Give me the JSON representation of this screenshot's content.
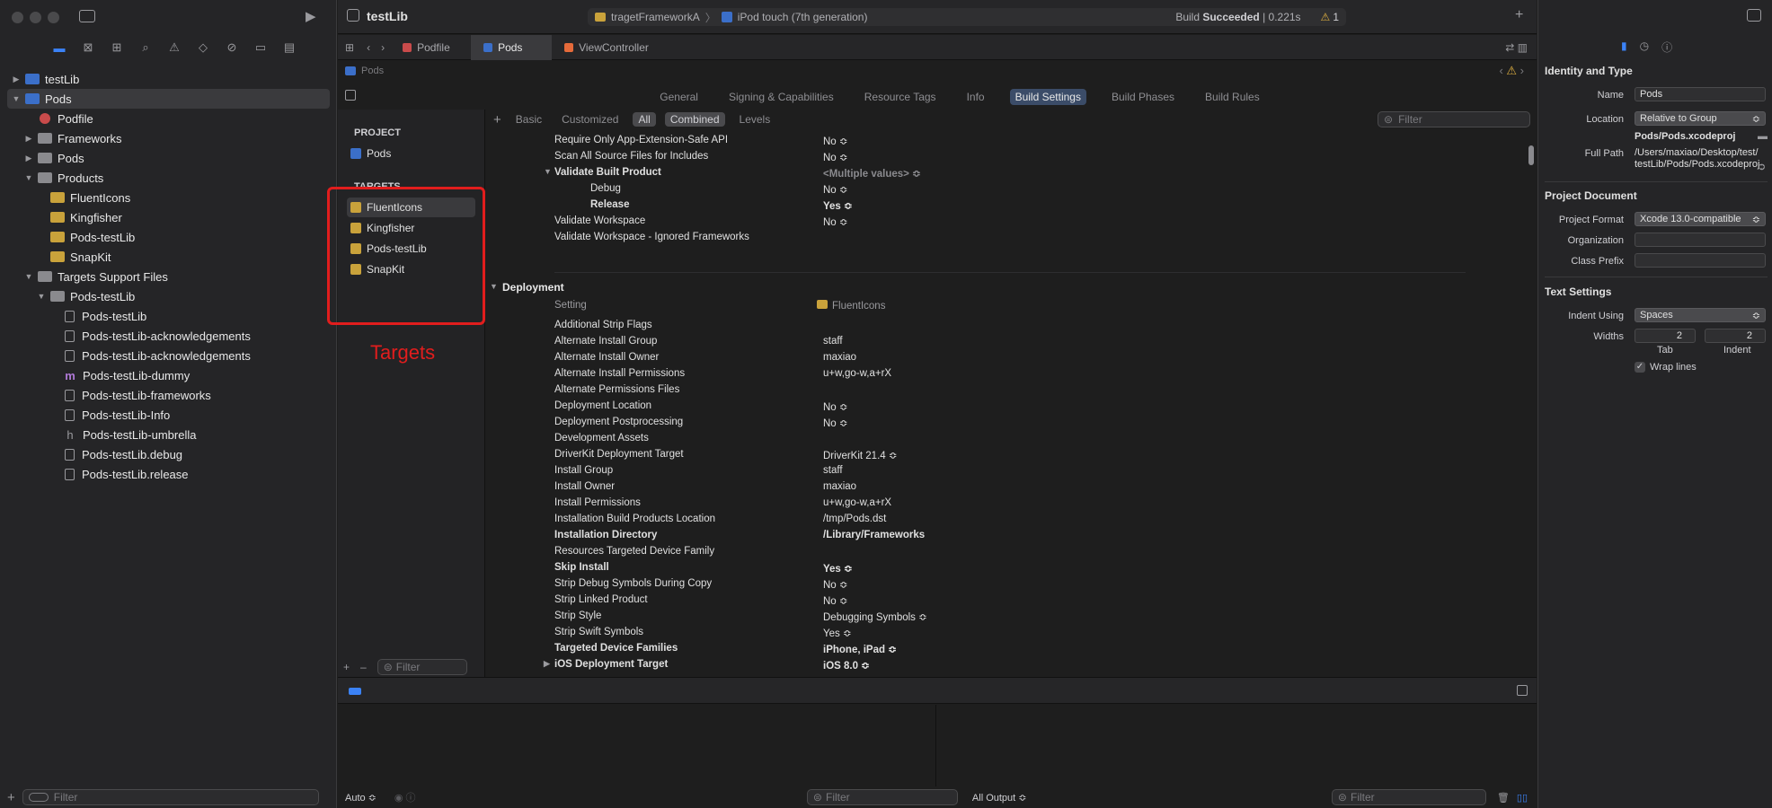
{
  "navigator": {
    "tree": [
      {
        "label": "testLib",
        "icon": "project-icon",
        "disc": "▶",
        "indent": 0
      },
      {
        "label": "Pods",
        "icon": "project-icon",
        "disc": "▼",
        "indent": 0,
        "selected": true
      },
      {
        "label": "Podfile",
        "icon": "podfile-icon",
        "disc": "",
        "indent": 1
      },
      {
        "label": "Frameworks",
        "icon": "folder-icon",
        "disc": "▶",
        "indent": 1
      },
      {
        "label": "Pods",
        "icon": "folder-icon",
        "disc": "▶",
        "indent": 1
      },
      {
        "label": "Products",
        "icon": "folder-icon",
        "disc": "▼",
        "indent": 1
      },
      {
        "label": "FluentIcons",
        "icon": "framework-icon",
        "disc": "",
        "indent": 2
      },
      {
        "label": "Kingfisher",
        "icon": "framework-icon",
        "disc": "",
        "indent": 2
      },
      {
        "label": "Pods-testLib",
        "icon": "framework-icon",
        "disc": "",
        "indent": 2
      },
      {
        "label": "SnapKit",
        "icon": "framework-icon",
        "disc": "",
        "indent": 2
      },
      {
        "label": "Targets Support Files",
        "icon": "folder-icon",
        "disc": "▼",
        "indent": 1
      },
      {
        "label": "Pods-testLib",
        "icon": "folder-icon",
        "disc": "▼",
        "indent": 2
      },
      {
        "label": "Pods-testLib",
        "icon": "modulemap-icon",
        "disc": "",
        "indent": 3
      },
      {
        "label": "Pods-testLib-acknowledgements",
        "icon": "markdown-icon",
        "disc": "",
        "indent": 3
      },
      {
        "label": "Pods-testLib-acknowledgements",
        "icon": "plist-icon",
        "disc": "",
        "indent": 3
      },
      {
        "label": "Pods-testLib-dummy",
        "icon": "objc-m-icon",
        "disc": "",
        "indent": 3
      },
      {
        "label": "Pods-testLib-frameworks",
        "icon": "script-icon",
        "disc": "",
        "indent": 3
      },
      {
        "label": "Pods-testLib-Info",
        "icon": "plist-icon",
        "disc": "",
        "indent": 3
      },
      {
        "label": "Pods-testLib-umbrella",
        "icon": "header-h-icon",
        "disc": "",
        "indent": 3
      },
      {
        "label": "Pods-testLib.debug",
        "icon": "xcconfig-icon",
        "disc": "",
        "indent": 3
      },
      {
        "label": "Pods-testLib.release",
        "icon": "xcconfig-icon",
        "disc": "",
        "indent": 3
      }
    ],
    "filter_placeholder": "Filter"
  },
  "titlebar": {
    "app_title": "testLib",
    "scheme": "tragetFrameworkA",
    "destination": "iPod touch (7th generation)",
    "status_prefix": "Build ",
    "status_bold": "Succeeded",
    "status_time": "| 0.221s",
    "warnings": "1"
  },
  "tabs": [
    {
      "label": "Podfile",
      "active": false
    },
    {
      "label": "Pods",
      "active": true
    },
    {
      "label": "ViewController",
      "active": false
    }
  ],
  "jumpbar": {
    "item": "Pods"
  },
  "editor_tabs": [
    "General",
    "Signing & Capabilities",
    "Resource Tags",
    "Info",
    "Build Settings",
    "Build Phases",
    "Build Rules"
  ],
  "active_editor_tab": "Build Settings",
  "project_pane": {
    "project_header": "PROJECT",
    "project_item": "Pods",
    "targets_header": "TARGETS",
    "targets": [
      "FluentIcons",
      "Kingfisher",
      "Pods-testLib",
      "SnapKit"
    ],
    "selected_target": "FluentIcons",
    "filter_placeholder": "Filter",
    "annotation": "Targets",
    "annotation_color": "#e11d1d"
  },
  "settings_filter": {
    "segments": [
      "Basic",
      "Customized",
      "All",
      "Combined",
      "Levels"
    ],
    "active": [
      "All",
      "Combined"
    ],
    "search_placeholder": "Filter"
  },
  "build_rows_top": [
    {
      "k": "Require Only App-Extension-Safe API",
      "v": "No ≎"
    },
    {
      "k": "Scan All Source Files for Includes",
      "v": "No ≎"
    },
    {
      "k": "Validate Built Product",
      "v": "<Multiple values> ≎",
      "bold": true,
      "gray": true,
      "disc": "▼"
    },
    {
      "k": "Debug",
      "v": "No ≎",
      "sub": true
    },
    {
      "k": "Release",
      "v": "Yes ≎",
      "sub": true,
      "bold": true
    },
    {
      "k": "Validate Workspace",
      "v": "No ≎"
    },
    {
      "k": "Validate Workspace - Ignored Frameworks",
      "v": ""
    }
  ],
  "deployment": {
    "section": "Deployment",
    "header_setting": "Setting",
    "header_target": "FluentIcons",
    "rows": [
      {
        "k": "Additional Strip Flags",
        "v": ""
      },
      {
        "k": "Alternate Install Group",
        "v": "staff"
      },
      {
        "k": "Alternate Install Owner",
        "v": "maxiao"
      },
      {
        "k": "Alternate Install Permissions",
        "v": "u+w,go-w,a+rX"
      },
      {
        "k": "Alternate Permissions Files",
        "v": ""
      },
      {
        "k": "Deployment Location",
        "v": "No ≎"
      },
      {
        "k": "Deployment Postprocessing",
        "v": "No ≎"
      },
      {
        "k": "Development Assets",
        "v": ""
      },
      {
        "k": "DriverKit Deployment Target",
        "v": "DriverKit 21.4 ≎"
      },
      {
        "k": "Install Group",
        "v": "staff"
      },
      {
        "k": "Install Owner",
        "v": "maxiao"
      },
      {
        "k": "Install Permissions",
        "v": "u+w,go-w,a+rX"
      },
      {
        "k": "Installation Build Products Location",
        "v": "/tmp/Pods.dst"
      },
      {
        "k": "Installation Directory",
        "v": "/Library/Frameworks",
        "bold": true
      },
      {
        "k": "Resources Targeted Device Family",
        "v": ""
      },
      {
        "k": "Skip Install",
        "v": "Yes ≎",
        "bold": true
      },
      {
        "k": "Strip Debug Symbols During Copy",
        "v": "No ≎"
      },
      {
        "k": "Strip Linked Product",
        "v": "No ≎"
      },
      {
        "k": "Strip Style",
        "v": "Debugging Symbols ≎"
      },
      {
        "k": "Strip Swift Symbols",
        "v": "Yes ≎"
      },
      {
        "k": "Targeted Device Families",
        "v": "iPhone, iPad ≎",
        "bold": true
      },
      {
        "k": "iOS Deployment Target",
        "v": "iOS 8.0 ≎",
        "bold": true,
        "disc": "▶"
      }
    ]
  },
  "console": {
    "auto_label": "Auto ≎",
    "filter_placeholder": "Filter",
    "output_label": "All Output ≎",
    "right_filter_placeholder": "Filter"
  },
  "inspector": {
    "identity_header": "Identity and Type",
    "name_label": "Name",
    "name_value": "Pods",
    "location_label": "Location",
    "location_value": "Relative to Group",
    "location_path": "Pods/Pods.xcodeproj",
    "full_path_label": "Full Path",
    "full_path_line1": "/Users/maxiao/Desktop/test/",
    "full_path_line2": "testLib/Pods/Pods.xcodeproj",
    "project_doc_header": "Project Document",
    "format_label": "Project Format",
    "format_value": "Xcode 13.0-compatible",
    "org_label": "Organization",
    "prefix_label": "Class Prefix",
    "text_header": "Text Settings",
    "indent_using_label": "Indent Using",
    "indent_using_value": "Spaces",
    "widths_label": "Widths",
    "tab_value": "2",
    "indent_value": "2",
    "tab_label": "Tab",
    "indent_label": "Indent",
    "wrap_label": "Wrap lines"
  },
  "accent": "#3b82f6"
}
